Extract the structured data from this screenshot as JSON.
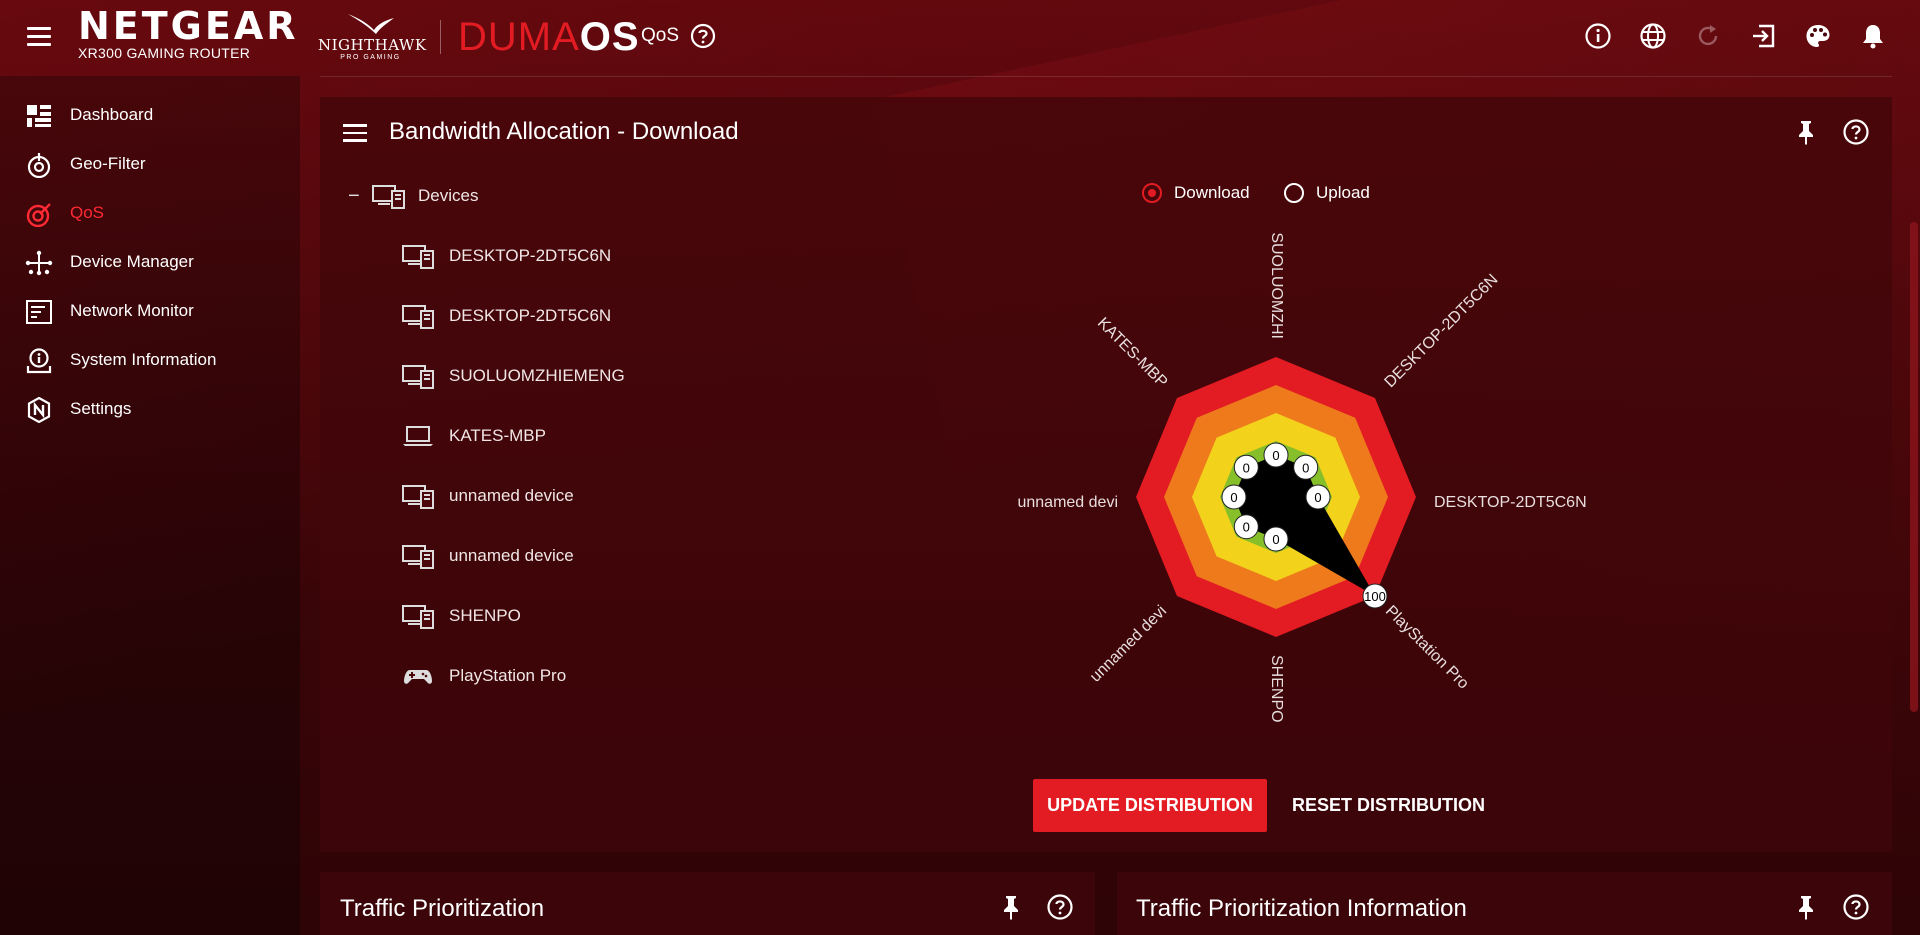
{
  "header": {
    "brand": "NETGEAR",
    "model": "XR300 GAMING ROUTER",
    "nighthawk_name": "NIGHTHAWK",
    "nighthawk_sub": "PRO GAMING",
    "os_duma": "DUMA",
    "os_os": "OS",
    "page_title": "QoS"
  },
  "sidebar": {
    "items": [
      {
        "label": "Dashboard",
        "icon": "dashboard-icon"
      },
      {
        "label": "Geo-Filter",
        "icon": "geo-filter-icon"
      },
      {
        "label": "QoS",
        "icon": "qos-icon",
        "active": true
      },
      {
        "label": "Device Manager",
        "icon": "device-manager-icon"
      },
      {
        "label": "Network Monitor",
        "icon": "network-monitor-icon"
      },
      {
        "label": "System Information",
        "icon": "system-information-icon"
      },
      {
        "label": "Settings",
        "icon": "settings-icon"
      }
    ]
  },
  "bandwidth_panel": {
    "title": "Bandwidth Allocation - Download",
    "tree_root": "Devices",
    "devices": [
      {
        "label": "DESKTOP-2DT5C6N",
        "icon": "desktop-icon"
      },
      {
        "label": "DESKTOP-2DT5C6N",
        "icon": "desktop-icon"
      },
      {
        "label": "SUOLUOMZHIEMENG",
        "icon": "desktop-icon"
      },
      {
        "label": "KATES-MBP",
        "icon": "laptop-icon"
      },
      {
        "label": "unnamed device",
        "icon": "desktop-icon"
      },
      {
        "label": "unnamed device",
        "icon": "desktop-icon"
      },
      {
        "label": "SHENPO",
        "icon": "desktop-icon"
      },
      {
        "label": "PlayStation Pro",
        "icon": "gamepad-icon"
      }
    ],
    "radio_download": "Download",
    "radio_upload": "Upload",
    "selected_direction": "Download",
    "update_button": "UPDATE DISTRIBUTION",
    "reset_button": "RESET DISTRIBUTION"
  },
  "chart_data": {
    "type": "radar",
    "axes": [
      "SUOLUOMZHI",
      "DESKTOP-2DT5C6N",
      "DESKTOP-2DT5C6N",
      "PlayStation Pro",
      "SHENPO",
      "unnamed devi",
      "unnamed devi",
      "KATES-MBP"
    ],
    "values": [
      0,
      0,
      0,
      100,
      0,
      0,
      0,
      0
    ],
    "value_labels": [
      "0",
      "0",
      "0",
      "100",
      "0",
      "0",
      "0",
      "0"
    ],
    "rings": 5,
    "ring_colors": [
      "#e31b23",
      "#ee7a1c",
      "#f2d21b",
      "#86bf2a",
      "#1f9b2e"
    ],
    "center_color": "#000000"
  },
  "bottom_panels": {
    "traffic_prioritization": "Traffic Prioritization",
    "traffic_prioritization_info": "Traffic Prioritization Information"
  }
}
